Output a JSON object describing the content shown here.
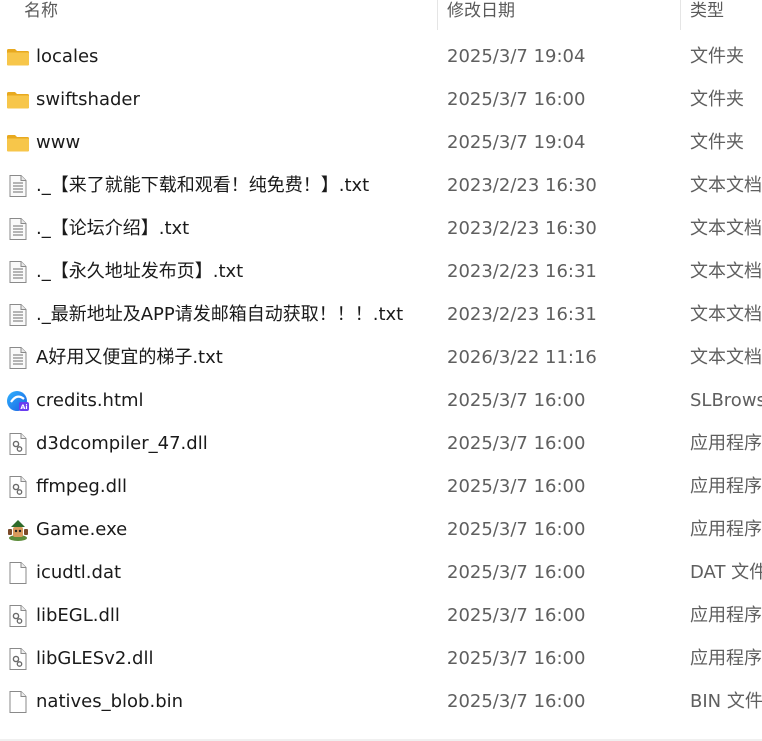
{
  "header": {
    "name": "名称",
    "date": "修改日期",
    "type": "类型"
  },
  "files": [
    {
      "name": "locales",
      "date": "2025/3/7 19:04",
      "type": "文件夹",
      "icon": "folder-icon"
    },
    {
      "name": "swiftshader",
      "date": "2025/3/7 16:00",
      "type": "文件夹",
      "icon": "folder-icon"
    },
    {
      "name": "www",
      "date": "2025/3/7 19:04",
      "type": "文件夹",
      "icon": "folder-icon"
    },
    {
      "name": "._【来了就能下载和观看！纯免费！】.txt",
      "date": "2023/2/23 16:30",
      "type": "文本文档",
      "icon": "text-file-icon"
    },
    {
      "name": "._【论坛介绍】.txt",
      "date": "2023/2/23 16:30",
      "type": "文本文档",
      "icon": "text-file-icon"
    },
    {
      "name": "._【永久地址发布页】.txt",
      "date": "2023/2/23 16:31",
      "type": "文本文档",
      "icon": "text-file-icon"
    },
    {
      "name": "._最新地址及APP请发邮箱自动获取！！！.txt",
      "date": "2023/2/23 16:31",
      "type": "文本文档",
      "icon": "text-file-icon"
    },
    {
      "name": "A好用又便宜的梯子.txt",
      "date": "2026/3/22 11:16",
      "type": "文本文档",
      "icon": "text-file-icon"
    },
    {
      "name": "credits.html",
      "date": "2025/3/7 16:00",
      "type": "SLBrowser",
      "icon": "browser-ai-icon"
    },
    {
      "name": "d3dcompiler_47.dll",
      "date": "2025/3/7 16:00",
      "type": "应用程序扩展",
      "icon": "dll-file-icon"
    },
    {
      "name": "ffmpeg.dll",
      "date": "2025/3/7 16:00",
      "type": "应用程序扩展",
      "icon": "dll-file-icon"
    },
    {
      "name": "Game.exe",
      "date": "2025/3/7 16:00",
      "type": "应用程序",
      "icon": "game-exe-icon"
    },
    {
      "name": "icudtl.dat",
      "date": "2025/3/7 16:00",
      "type": "DAT 文件",
      "icon": "blank-file-icon"
    },
    {
      "name": "libEGL.dll",
      "date": "2025/3/7 16:00",
      "type": "应用程序扩展",
      "icon": "dll-file-icon"
    },
    {
      "name": "libGLESv2.dll",
      "date": "2025/3/7 16:00",
      "type": "应用程序扩展",
      "icon": "dll-file-icon"
    },
    {
      "name": "natives_blob.bin",
      "date": "2025/3/7 16:00",
      "type": "BIN 文件",
      "icon": "blank-file-icon"
    }
  ],
  "colors": {
    "folder": "#f7c64a",
    "folder_dark": "#e8a91f",
    "text_secondary": "#5f5f5f",
    "header_text": "#5a5a5a"
  }
}
